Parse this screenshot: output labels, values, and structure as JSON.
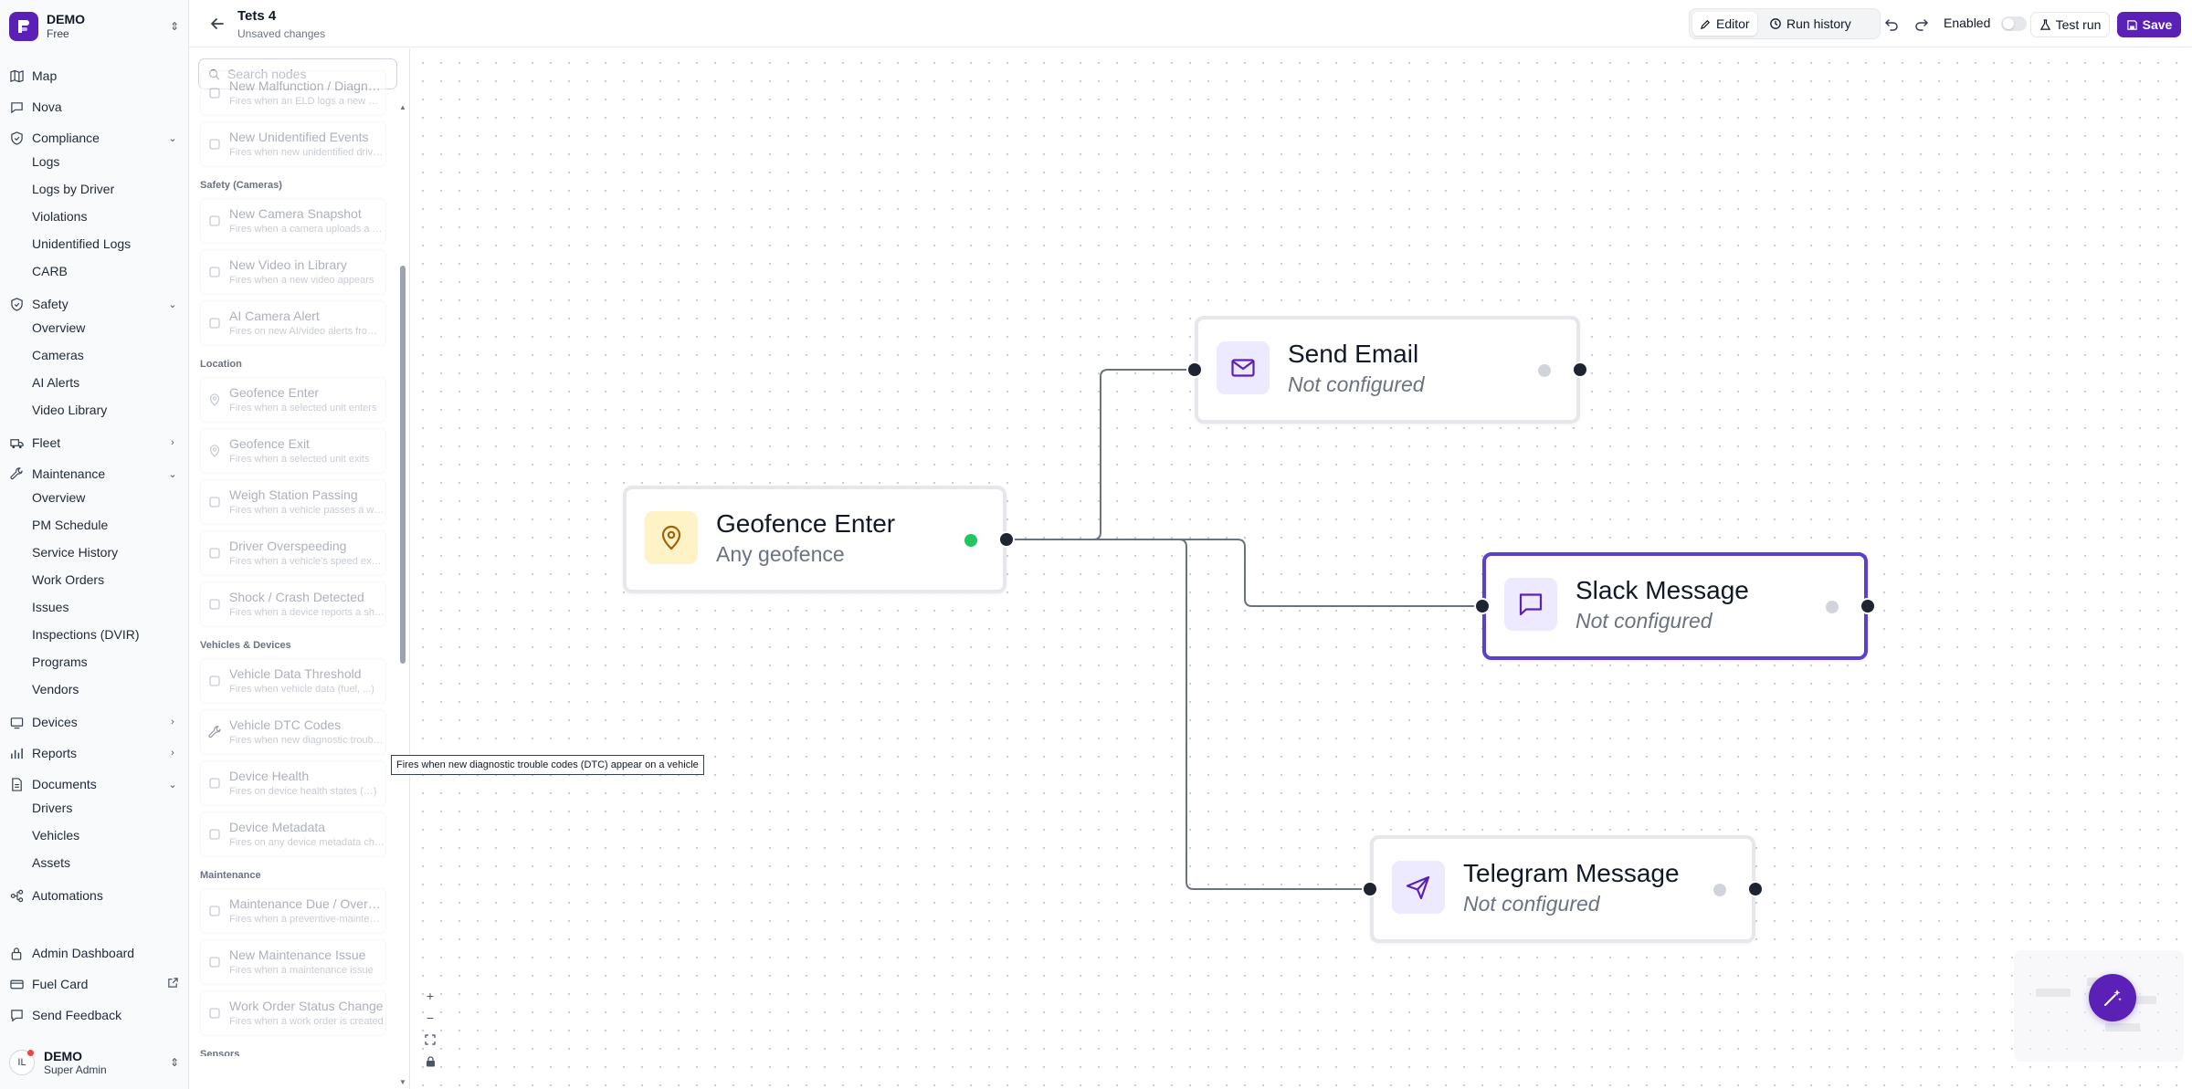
{
  "sidebar": {
    "org_name": "DEMO",
    "org_plan": "Free",
    "items": [
      {
        "label": "Map",
        "icon": "map-icon"
      },
      {
        "label": "Nova",
        "icon": "nova-icon"
      },
      {
        "label": "Compliance",
        "icon": "shield-check-icon",
        "expanded": true,
        "children": [
          "Logs",
          "Logs by Driver",
          "Violations",
          "Unidentified Logs",
          "CARB"
        ]
      },
      {
        "label": "Safety",
        "icon": "shield-icon",
        "expanded": true,
        "children": [
          "Overview",
          "Cameras",
          "AI Alerts",
          "Video Library"
        ]
      },
      {
        "label": "Fleet",
        "icon": "truck-icon",
        "expanded": false
      },
      {
        "label": "Maintenance",
        "icon": "wrench-icon",
        "expanded": true,
        "children": [
          "Overview",
          "PM Schedule",
          "Service History",
          "Work Orders",
          "Issues",
          "Inspections (DVIR)",
          "Programs",
          "Vendors"
        ]
      },
      {
        "label": "Devices",
        "icon": "device-icon",
        "expanded": false
      },
      {
        "label": "Reports",
        "icon": "reports-icon",
        "expanded": false
      },
      {
        "label": "Documents",
        "icon": "document-icon",
        "expanded": true,
        "children": [
          "Drivers",
          "Vehicles",
          "Assets"
        ]
      },
      {
        "label": "Automations",
        "icon": "automation-icon"
      }
    ],
    "bottom_items": [
      {
        "label": "Admin Dashboard",
        "icon": "lock-icon"
      },
      {
        "label": "Fuel Card",
        "icon": "fuel-card-icon"
      },
      {
        "label": "Send Feedback",
        "icon": "feedback-icon"
      }
    ],
    "user": {
      "initials": "IL",
      "name": "DEMO",
      "role": "Super Admin"
    }
  },
  "header": {
    "title": "Tets 4",
    "subtitle": "Unsaved changes",
    "editor_label": "Editor",
    "run_history_label": "Run history",
    "enabled_label": "Enabled",
    "enabled": false,
    "test_run_label": "Test run",
    "save_label": "Save"
  },
  "palette": {
    "search_placeholder": "Search nodes",
    "categories": [
      {
        "name": "",
        "nodes": [
          {
            "title": "New Malfunction / Diagnostic",
            "desc": "Fires when an ELD logs a new malfunction",
            "icon": "malfunction-icon"
          },
          {
            "title": "New Unidentified Events",
            "desc": "Fires when new unidentified driving events",
            "icon": "user-question-icon"
          }
        ]
      },
      {
        "name": "Safety (Cameras)",
        "nodes": [
          {
            "title": "New Camera Snapshot",
            "desc": "Fires when a camera uploads a snapshot",
            "icon": "camera-icon"
          },
          {
            "title": "New Video in Library",
            "desc": "Fires when a new video appears",
            "icon": "video-icon"
          },
          {
            "title": "AI Camera Alert",
            "desc": "Fires on new AI/video alerts from cameras",
            "icon": "sparkle-icon"
          }
        ]
      },
      {
        "name": "Location",
        "nodes": [
          {
            "title": "Geofence Enter",
            "desc": "Fires when a selected unit enters",
            "icon": "pin-icon"
          },
          {
            "title": "Geofence Exit",
            "desc": "Fires when a selected unit exits",
            "icon": "pin-icon"
          },
          {
            "title": "Weigh Station Passing",
            "desc": "Fires when a vehicle passes a weigh station",
            "icon": "scale-icon"
          },
          {
            "title": "Driver Overspeeding",
            "desc": "Fires when a vehicle's speed exceeds",
            "icon": "gauge-icon"
          },
          {
            "title": "Shock / Crash Detected",
            "desc": "Fires when a device reports a shock",
            "icon": "alert-icon"
          }
        ]
      },
      {
        "name": "Vehicles & Devices",
        "nodes": [
          {
            "title": "Vehicle Data Threshold",
            "desc": "Fires when vehicle data (fuel, ...)",
            "icon": "data-icon"
          },
          {
            "title": "Vehicle DTC Codes",
            "desc": "Fires when new diagnostic trouble codes",
            "icon": "wrench-icon"
          },
          {
            "title": "Device Health",
            "desc": "Fires on device health states (…)",
            "icon": "heart-icon"
          },
          {
            "title": "Device Metadata",
            "desc": "Fires on any device metadata change",
            "icon": "bolt-icon"
          }
        ]
      },
      {
        "name": "Maintenance",
        "nodes": [
          {
            "title": "Maintenance Due / Overdue",
            "desc": "Fires when a preventive-maintenance",
            "icon": "calendar-icon"
          },
          {
            "title": "New Maintenance Issue",
            "desc": "Fires when a maintenance issue",
            "icon": "alert-circle-icon"
          },
          {
            "title": "Work Order Status Change",
            "desc": "Fires when a work order is created",
            "icon": "clipboard-icon"
          }
        ]
      },
      {
        "name": "Sensors",
        "nodes": []
      }
    ],
    "tooltip": "Fires when new diagnostic trouble codes (DTC) appear on a vehicle"
  },
  "flow": {
    "nodes": [
      {
        "id": "geofence",
        "title": "Geofence Enter",
        "subtitle": "Any geofence",
        "configured": true,
        "icon": "pin-icon",
        "accent": "#a16207",
        "icon_bg": "#fef3c7"
      },
      {
        "id": "email",
        "title": "Send Email",
        "subtitle": "Not configured",
        "configured": false,
        "icon": "mail-icon",
        "accent": "#5b21b6",
        "icon_bg": "#ede9fe"
      },
      {
        "id": "slack",
        "title": "Slack Message",
        "subtitle": "Not configured",
        "configured": false,
        "icon": "message-icon",
        "accent": "#5b21b6",
        "icon_bg": "#ede9fe",
        "selected": true
      },
      {
        "id": "telegram",
        "title": "Telegram Message",
        "subtitle": "Not configured",
        "configured": false,
        "icon": "send-icon",
        "accent": "#5b21b6",
        "icon_bg": "#ede9fe"
      }
    ],
    "edges": [
      [
        "geofence",
        "email"
      ],
      [
        "geofence",
        "slack"
      ],
      [
        "geofence",
        "telegram"
      ]
    ]
  },
  "colors": {
    "brand": "#5b21b6",
    "selected": "#5b3fd0",
    "ok": "#22c55e"
  }
}
